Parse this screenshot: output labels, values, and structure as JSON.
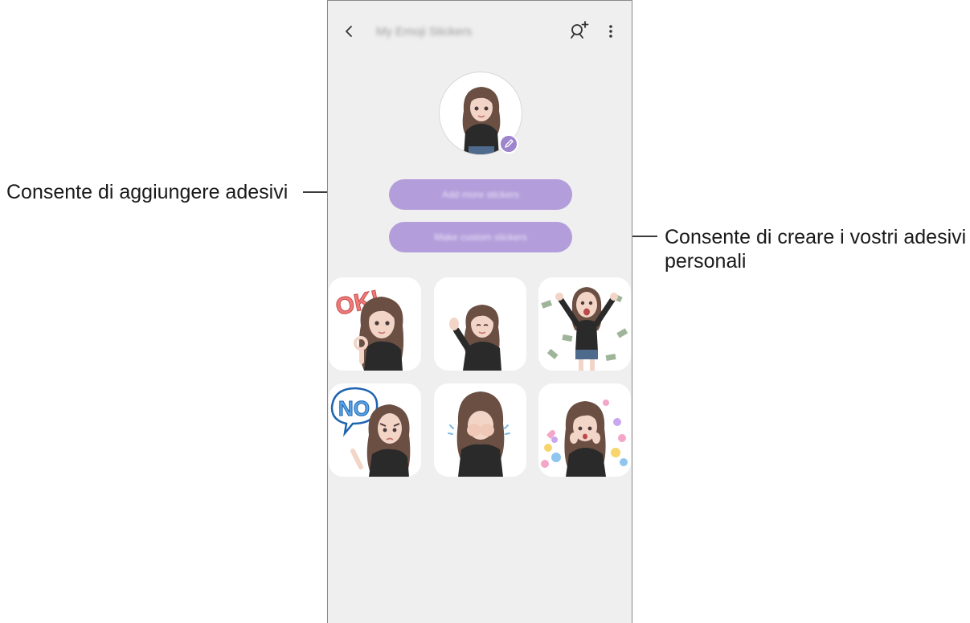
{
  "callouts": {
    "left_text": "Consente di aggiungere adesivi",
    "right_text_line1": "Consente di creare i vostri adesivi",
    "right_text_line2": "personali"
  },
  "app": {
    "title": "My Emoji Stickers",
    "back_icon": "chevron-left-icon",
    "add_avatar_icon": "add-avatar-icon",
    "more_icon": "more-vert-icon"
  },
  "buttons": {
    "add_stickers": "Add more stickers",
    "make_stickers": "Make custom stickers"
  },
  "stickers": [
    {
      "caption": "OK!",
      "style": "ok"
    },
    {
      "caption": "",
      "style": "wave"
    },
    {
      "caption": "",
      "style": "money"
    },
    {
      "caption": "NO",
      "style": "no"
    },
    {
      "caption": "",
      "style": "cry"
    },
    {
      "caption": "",
      "style": "hearts"
    }
  ],
  "colors": {
    "accent_purple": "#b39ddb",
    "background": "#efefef",
    "hair": "#6b4f43",
    "shirt": "#2a2a2a"
  }
}
